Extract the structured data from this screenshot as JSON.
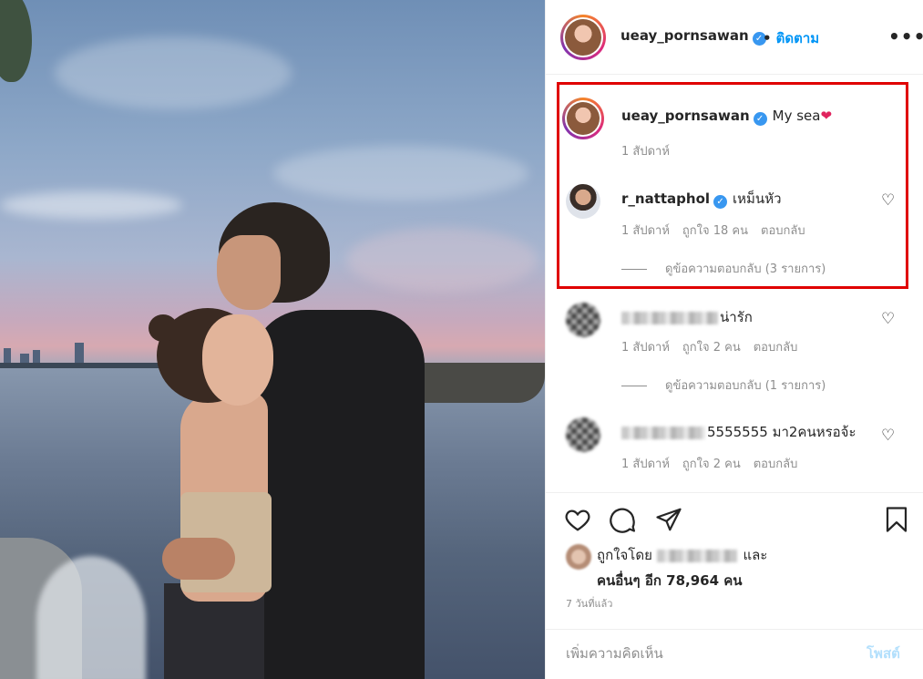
{
  "post": {
    "author": "ueay_pornsawan",
    "follow_label": "ติดตาม",
    "more_label": "•••"
  },
  "comments": [
    {
      "user": "ueay_pornsawan",
      "text": "My sea",
      "emoji": "❤",
      "time": "1 สัปดาห์"
    },
    {
      "user": "r_nattaphol",
      "text": "เหม็นหัว",
      "time": "1 สัปดาห์",
      "likes": "ถูกใจ 18 คน",
      "reply": "ตอบกลับ",
      "view_replies": "ดูข้อความตอบกลับ (3 รายการ)"
    },
    {
      "user": "",
      "text": "น่ารัก",
      "time": "1 สัปดาห์",
      "likes": "ถูกใจ 2 คน",
      "reply": "ตอบกลับ",
      "view_replies": "ดูข้อความตอบกลับ (1 รายการ)"
    },
    {
      "user": "",
      "text": "5555555 มา2คนหรอจ้ะ",
      "time": "1 สัปดาห์",
      "likes": "ถูกใจ 2 คน",
      "reply": "ตอบกลับ"
    }
  ],
  "likes_line1_prefix": "ถูกใจโดย",
  "likes_line1_suffix": "และ",
  "likes_line2": "คนอื่นๆ อีก 78,964 คน",
  "posted_time": "7 วันที่แล้ว",
  "add_comment_placeholder": "เพิ่มความคิดเห็น",
  "post_button": "โพสต์",
  "icons": [
    "heart-icon",
    "comment-icon",
    "share-icon",
    "bookmark-icon",
    "verified-icon",
    "more-icon"
  ],
  "colors": {
    "accent": "#0095f6",
    "highlight": "#e00000",
    "verified": "#3897f0"
  }
}
